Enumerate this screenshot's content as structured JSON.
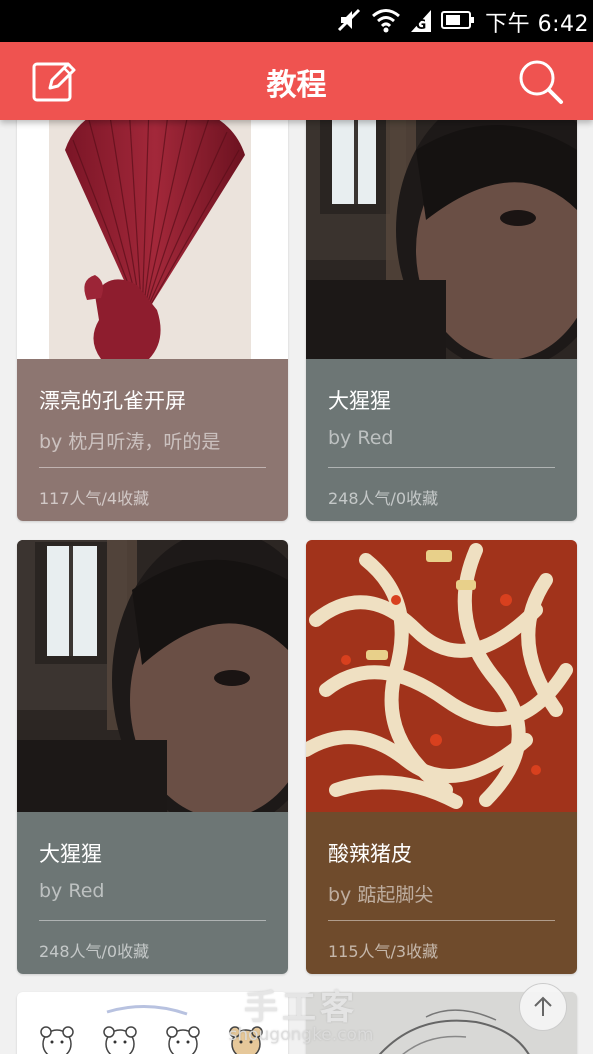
{
  "status_bar": {
    "time": "下午 6:42",
    "icons": [
      "mute-icon",
      "wifi-icon",
      "signal-icon",
      "battery-icon"
    ]
  },
  "app_bar": {
    "title": "教程",
    "left_icon": "edit-icon",
    "right_icon": "search-icon",
    "color": "#ef5350"
  },
  "cards": [
    {
      "title": "漂亮的孔雀开屏",
      "author": "by 枕月听涛，听的是",
      "stats": "117人气/4收藏",
      "info_color": "#8d7671",
      "image": "red paper peacock fan"
    },
    {
      "title": "大猩猩",
      "author": "by Red",
      "stats": "248人气/0收藏",
      "info_color": "#6d7675",
      "image": "dark selfie photo"
    },
    {
      "title": "大猩猩",
      "author": "by Red",
      "stats": "248人气/0收藏",
      "info_color": "#6d7675",
      "image": "dark selfie photo"
    },
    {
      "title": "酸辣猪皮",
      "author": "by 踮起脚尖",
      "stats": "115人气/3收藏",
      "info_color": "#6f4b2c",
      "image": "spicy noodle dish"
    }
  ],
  "watermark": {
    "main": "手工客",
    "sub": "shougongke.com"
  },
  "back_to_top_icon": "arrow-up-icon"
}
